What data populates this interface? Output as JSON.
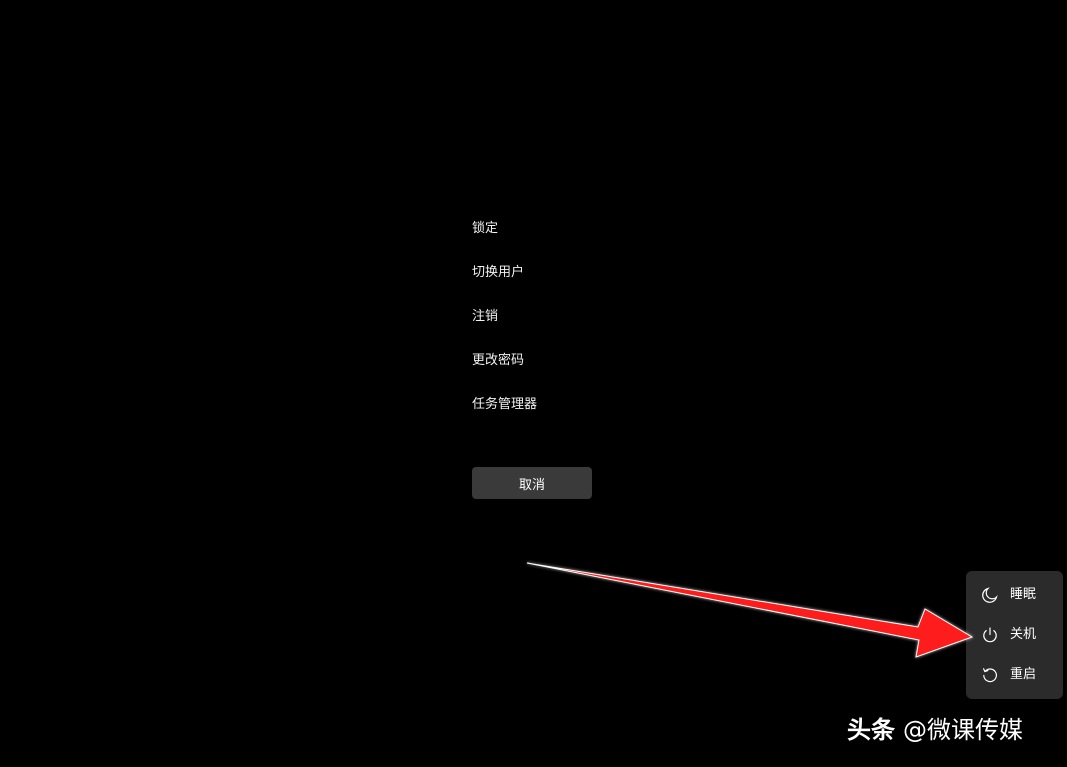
{
  "options": {
    "lock": "锁定",
    "switch_user": "切换用户",
    "sign_out": "注销",
    "change_password": "更改密码",
    "task_manager": "任务管理器"
  },
  "cancel_label": "取消",
  "power_menu": {
    "items": [
      {
        "label": "睡眠",
        "icon": "moon-icon"
      },
      {
        "label": "关机",
        "icon": "power-icon"
      },
      {
        "label": "重启",
        "icon": "restart-icon"
      }
    ]
  },
  "watermark": {
    "brand": "头条",
    "handle": "@微课传媒"
  },
  "colors": {
    "background": "#000000",
    "menu_background": "#2b2b2b",
    "button_background": "#3a3a3a",
    "annotation_arrow": "#ff1a1a"
  }
}
